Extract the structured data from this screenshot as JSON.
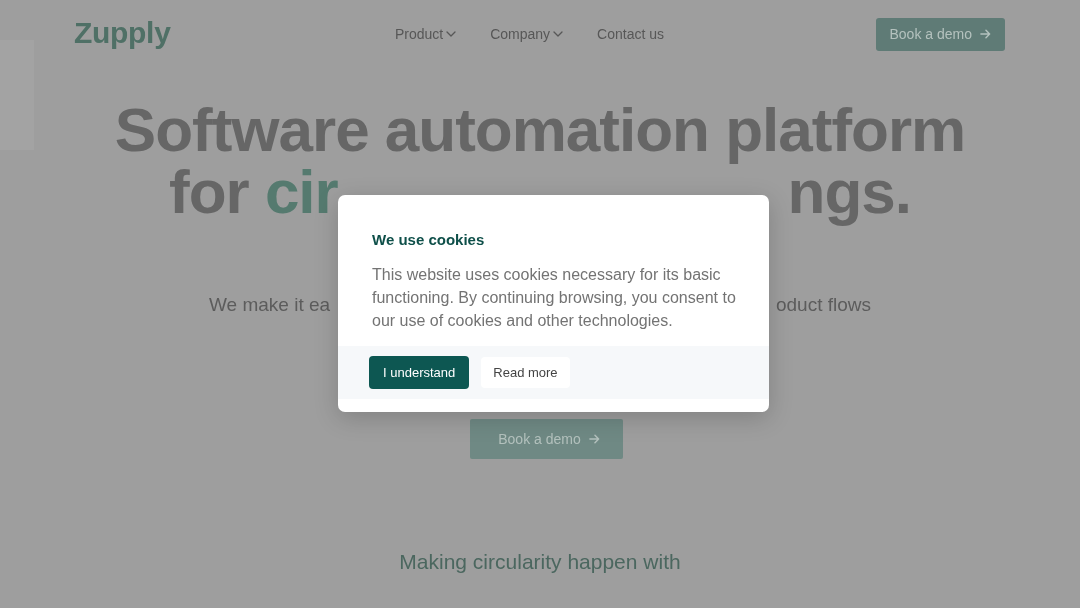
{
  "header": {
    "logo": "Zupply",
    "nav": [
      {
        "label": "Product",
        "has_dropdown": true
      },
      {
        "label": "Company",
        "has_dropdown": true
      },
      {
        "label": "Contact us",
        "has_dropdown": false
      }
    ],
    "cta": {
      "label": "Book a demo"
    }
  },
  "hero": {
    "headline": {
      "line_1": [
        {
          "text": "Software automation platform",
          "accent": false
        }
      ],
      "line_2": {
        "left": [
          {
            "text": "for ",
            "accent": false
          },
          {
            "text": "cir",
            "accent": true
          }
        ],
        "right": [
          {
            "text": "ngs.",
            "accent": false
          }
        ]
      }
    },
    "subtitle": {
      "left": "We make it ea",
      "right": "oduct flows"
    },
    "cta": {
      "label": "Book a demo"
    }
  },
  "partners_heading": "Making circularity happen with",
  "cookie_dialog": {
    "title": "We use cookies",
    "message": "This website uses cookies necessary for its basic functioning. By continuing browsing, you consent to our use of cookies and other technologies.",
    "buttons": [
      {
        "label": "I understand",
        "kind": "primary"
      },
      {
        "label": "Read more",
        "kind": "secondary"
      }
    ]
  }
}
